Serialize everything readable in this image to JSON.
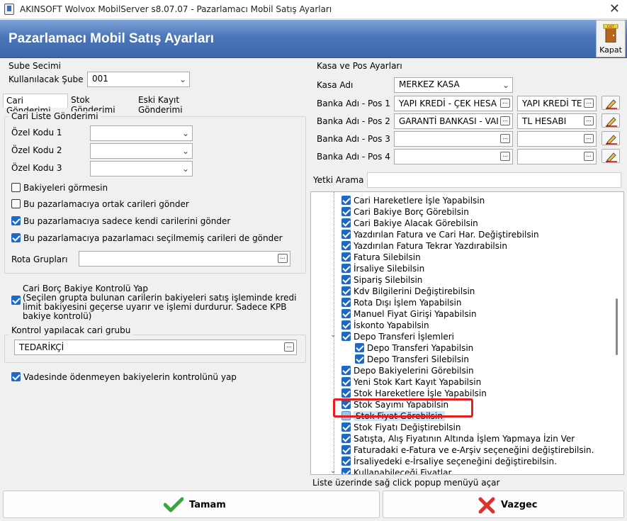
{
  "window": {
    "title": "AKINSOFT Wolvox MobilServer s8.07.07 - Pazarlamacı Mobil Satış Ayarları",
    "close_glyph": "✕"
  },
  "header": {
    "title": "Pazarlamacı Mobil Satış Ayarları",
    "kapat_label": "Kapat",
    "exit_sign": "EXIT"
  },
  "left": {
    "sube_group": "Sube Secimi",
    "kullanilacak_sube_label": "Kullanılacak Şube",
    "kullanilacak_sube_value": "001",
    "tabs": [
      "Cari Gönderimi",
      "Stok Gönderimi",
      "Eski Kayıt Gönderimi"
    ],
    "cari_liste_group": "Cari Liste Gönderimi",
    "ozel_kodu_1": "Özel Kodu 1",
    "ozel_kodu_2": "Özel Kodu 2",
    "ozel_kodu_3": "Özel Kodu 3",
    "bakiye_gormesin": "Bakiyeleri görmesin",
    "ortak_cariler": "Bu pazarlamacıya ortak carileri gönder",
    "kendi_cariler": "Bu pazarlamacıya sadece kendi carilerini gönder",
    "secilmemis_cariler": "Bu pazarlamacıya pazarlamacı seçilmemiş carileri de gönder",
    "rota_label": "Rota Grupları",
    "rota_value": "",
    "borc_kontrol_line1": "Cari Borç Bakiye Kontrolü Yap",
    "borc_kontrol_line2": "(Seçilen grupta bulunan carilerin bakiyeleri satış işleminde kredi",
    "borc_kontrol_line3": "limit bakiyesini geçerse uyarır ve işlemi durdurur. Sadece KPB",
    "borc_kontrol_line4": "bakiye kontrolü)",
    "kontrol_group": "Kontrol yapılacak cari grubu",
    "kontrol_value": "TEDARİKÇİ",
    "vadesinde": "Vadesinde ödenmeyen bakiyelerin kontrolünü yap"
  },
  "right": {
    "kasa_pos_group": "Kasa ve Pos Ayarları",
    "kasa_adi_label": "Kasa Adı",
    "kasa_adi_value": "MERKEZ KASA",
    "pos1_label": "Banka Adı - Pos 1",
    "pos1_bank": "YAPI KREDİ - ÇEK HESA",
    "pos1_account": "YAPI KREDİ TE",
    "pos2_label": "Banka Adı - Pos 2",
    "pos2_bank": "GARANTİ BANKASI - VAI",
    "pos2_account": "TL HESABI",
    "pos3_label": "Banka Adı - Pos 3",
    "pos4_label": "Banka Adı - Pos 4",
    "yetki_label": "Yetki Arama",
    "yetki_value": "",
    "tree": [
      {
        "label": "Cari Hareketlere İşle Yapabilsin",
        "checked": true
      },
      {
        "label": "Cari Bakiye Borç Görebilsin",
        "checked": true
      },
      {
        "label": "Cari Bakiye Alacak Görebilsin",
        "checked": true
      },
      {
        "label": "Yazdırılan Fatura ve Cari Har. Değiştirebilsin",
        "checked": true
      },
      {
        "label": "Yazdırılan Fatura Tekrar Yazdırabilsin",
        "checked": true
      },
      {
        "label": "Fatura Silebilsin",
        "checked": true
      },
      {
        "label": "İrsaliye Silebilsin",
        "checked": true
      },
      {
        "label": "Sipariş Silebilsin",
        "checked": true
      },
      {
        "label": "Kdv Bilgilerini Değiştirebilsin",
        "checked": true
      },
      {
        "label": "Rota Dışı İşlem Yapabilsin",
        "checked": true
      },
      {
        "label": "Manuel Fiyat Girişi Yapabilsin",
        "checked": true
      },
      {
        "label": "İskonto Yapabilsin",
        "checked": true
      },
      {
        "label": "Depo Transferi İşlemleri",
        "checked": true
      },
      {
        "label": "Depo Transferi Yapabilsin",
        "checked": true
      },
      {
        "label": "Depo Transferi Silebilsin",
        "checked": true
      },
      {
        "label": "Depo Bakiyelerini Görebilsin",
        "checked": true
      },
      {
        "label": "Yeni Stok Kart Kayıt Yapabilsin",
        "checked": true
      },
      {
        "label": "Stok Hareketlere İşle Yapabilsin",
        "checked": true
      },
      {
        "label": "Stok Sayımı Yapabilsin",
        "checked": true
      },
      {
        "label": "Stok Fiyat Görebilsin",
        "checked": false
      },
      {
        "label": "Stok Fiyatı Değiştirebilsin",
        "checked": true
      },
      {
        "label": "Satışta, Alış Fiyatının Altında İşlem Yapmaya İzin Ver",
        "checked": true
      },
      {
        "label": "Faturadaki e-Fatura ve e-Arşiv  seçeneğini değiştirebilsin.",
        "checked": true
      },
      {
        "label": "İrsaliyedeki e-İrsaliye seçeneğini değiştirebilsin.",
        "checked": true
      },
      {
        "label": "Kullanabileceği Fiyatlar",
        "checked": true
      }
    ],
    "status": "Liste üzerinde sağ click popup menüyü açar"
  },
  "buttons": {
    "ok": "Tamam",
    "cancel": "Vazgec"
  },
  "colors": {
    "header_blue": "#4a76b8",
    "check_blue": "#1e69c6",
    "highlight_red": "#e02020"
  }
}
